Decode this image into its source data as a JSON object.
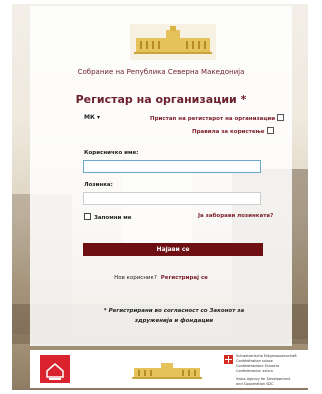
{
  "header": {
    "assembly_name": "Собрание на Република Северна Македонија",
    "title": "Регистар на организации *",
    "language": "МК ▾",
    "register_link": "Пристап на регистарот на организации",
    "terms_link": "Правила за користење"
  },
  "form": {
    "username_label": "Корисничко име:",
    "username_value": "",
    "password_label": "Лозинка:",
    "password_value": "",
    "remember_label": "Запомни ме",
    "forgot_link": "Ја заборави лозинката?",
    "login_button": "Најави се",
    "new_user_text": "Нов корисник?",
    "register_link": "Регистрирај се",
    "note": "* Регистрирани во согласност со Законот за здруженија и фондации"
  },
  "footer": {
    "logo_left_text": "",
    "swiss_text_line1": "Schweizerische Eidgenossenschaft",
    "swiss_text_line2": "Confédération suisse",
    "swiss_text_line3": "Confederazione Svizzera",
    "swiss_text_line4": "Confederaziun svizra",
    "swiss_text_line5": "Swiss Agency for Development",
    "swiss_text_line6": "and Cooperation SDC"
  },
  "colors": {
    "accent": "#6e0f14",
    "link": "#7a1c2a"
  }
}
